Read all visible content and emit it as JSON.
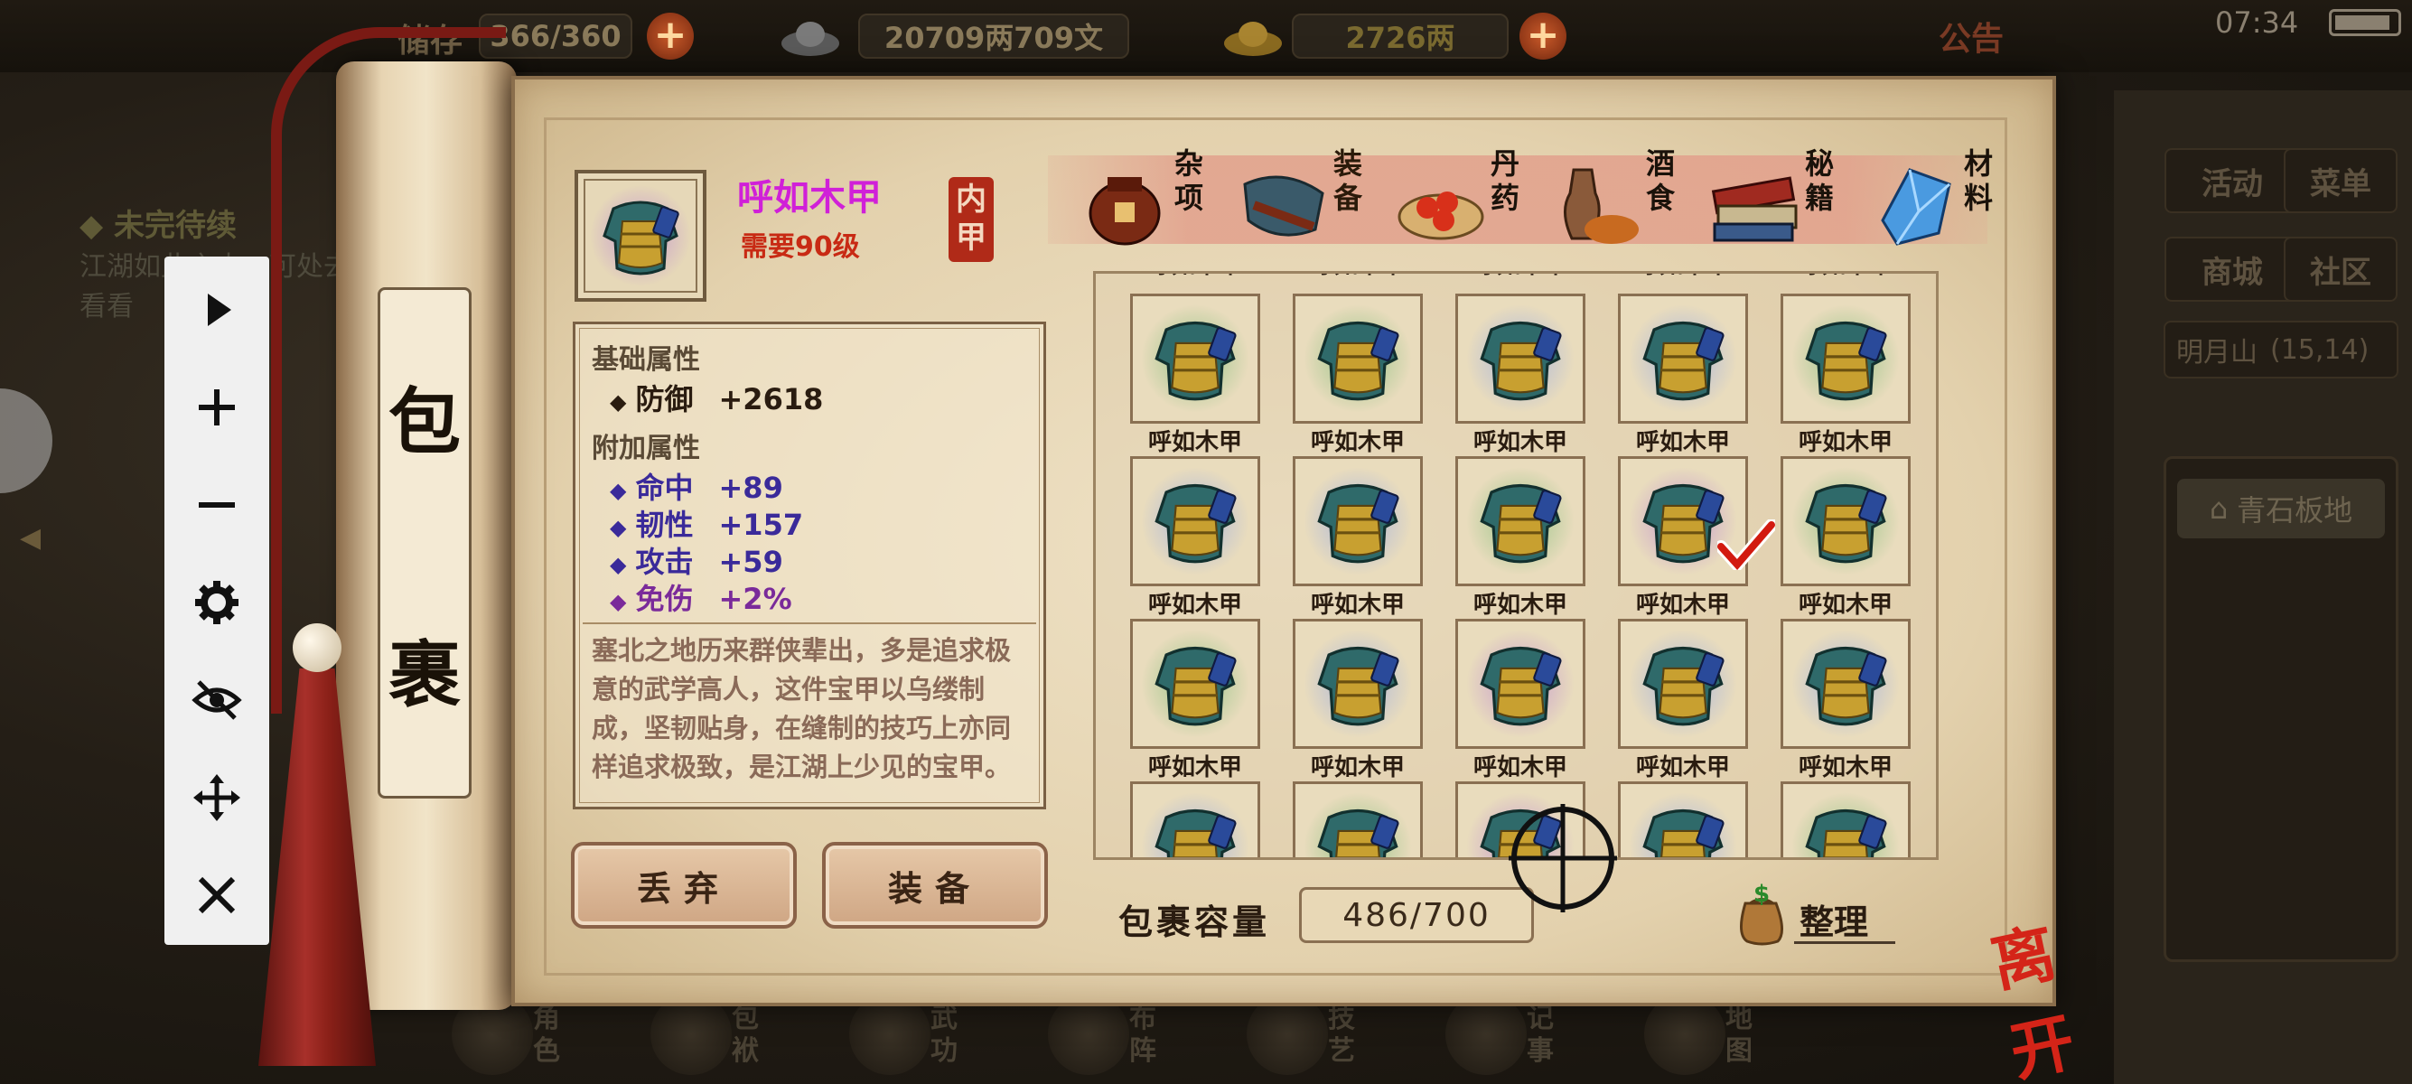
{
  "top_bar": {
    "storage_label": "储存",
    "storage_value": "366/360",
    "money": "20709两709文",
    "gold": "2726两",
    "announcement": "公告",
    "time": "07:34"
  },
  "quest": {
    "title": "未完待续",
    "desc": "江湖如此之大，可处去看看"
  },
  "right_menu": {
    "activity": "活动",
    "menu": "菜单",
    "shop": "商城",
    "community": "社区",
    "location": "明月山",
    "coords": "(15,14)",
    "place": "青石板地"
  },
  "bottom_nav": [
    "角色",
    "包袱",
    "武功",
    "布阵",
    "技艺",
    "记事",
    "地图"
  ],
  "panel": {
    "rod_title_1": "包",
    "rod_title_2": "裹",
    "item_name": "呼如木甲",
    "item_requirement": "需要90级",
    "item_type": "内甲",
    "base_header": "基础属性",
    "base_attrs": [
      {
        "name": "防御",
        "value": "+2618"
      }
    ],
    "extra_header": "附加属性",
    "extra_attrs": [
      {
        "name": "命中",
        "value": "+89",
        "color": "#3a2a9a"
      },
      {
        "name": "韧性",
        "value": "+157",
        "color": "#3a2a9a"
      },
      {
        "name": "攻击",
        "value": "+59",
        "color": "#3a2a9a"
      },
      {
        "name": "免伤",
        "value": "+2%",
        "color": "#7a2a9a"
      }
    ],
    "description": "塞北之地历来群侠辈出，多是追求极意的武学高人，这件宝甲以乌缕制成，坚韧贴身，在缝制的技巧上亦同样追求极致，是江湖上少见的宝甲。",
    "discard_button": "丢弃",
    "equip_button": "装备",
    "capacity_label": "包裹容量",
    "capacity_value": "486/700",
    "sort_button": "整理",
    "leave_button": "离开"
  },
  "tabs": [
    {
      "label": "杂项",
      "icon": "jar-icon"
    },
    {
      "label": "装备",
      "icon": "equipment-icon",
      "active": true
    },
    {
      "label": "丹药",
      "icon": "pill-icon"
    },
    {
      "label": "酒食",
      "icon": "food-icon"
    },
    {
      "label": "秘籍",
      "icon": "book-icon"
    },
    {
      "label": "材料",
      "icon": "crystal-icon"
    }
  ],
  "grid": {
    "item_label": "呼如木甲",
    "rows": 4,
    "cols": 5,
    "selected_index": 8,
    "glow_colors": [
      "#8cc080",
      "#8cc080",
      "#a0b0e0",
      "#a0b0e0",
      "#8cc080",
      "#a0b0e0",
      "#a0b0e0",
      "#8cc080",
      "#c090d0",
      "#8cc080",
      "#8cc080",
      "#a0b0e0",
      "#c090d0",
      "#a0b0e0",
      "#a0b0e0",
      "#a0b0e0",
      "#8cc080",
      "#c090d0",
      "#a0b0e0",
      "#8cc080"
    ]
  },
  "toolbar": [
    "play-icon",
    "zoom-in-icon",
    "zoom-out-icon",
    "settings-icon",
    "hide-icon",
    "move-icon",
    "close-icon"
  ]
}
